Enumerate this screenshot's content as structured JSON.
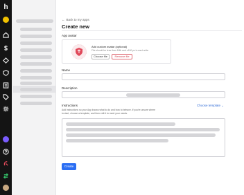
{
  "rail": {
    "logo_text": "h",
    "icons": [
      "workspace-badge-icon",
      "home-icon",
      "dollar-icon",
      "diamond-icon",
      "shield-icon",
      "document-icon",
      "tag-icon",
      "settings-icon",
      "purple-app-icon",
      "help-icon",
      "integration-icon",
      "exchange-icon",
      "user-avatar-icon"
    ]
  },
  "main": {
    "back_link": "Back to my apps",
    "page_title": "Create new",
    "app_avatar": {
      "label": "App avatar",
      "upload_title": "Add custom avatar (optional)",
      "upload_hint": "File should be less than 1Mb and ≤100 px in each side.",
      "choose_button": "Choose file",
      "remove_button": "Remove file"
    },
    "name": {
      "label": "Name"
    },
    "description": {
      "label": "Description"
    },
    "instructions": {
      "label": "Instructions",
      "choose_template": "Choose template",
      "hint_line1": "Add instructions so your App knows what to do and how to behave. If you're unsure where",
      "hint_line2": "to start, choose a template, and then edit it to meet your needs."
    },
    "create_button": "Create"
  },
  "colors": {
    "accent": "#2b6ef3",
    "danger": "#d0404d",
    "rail_bg": "#141414"
  }
}
